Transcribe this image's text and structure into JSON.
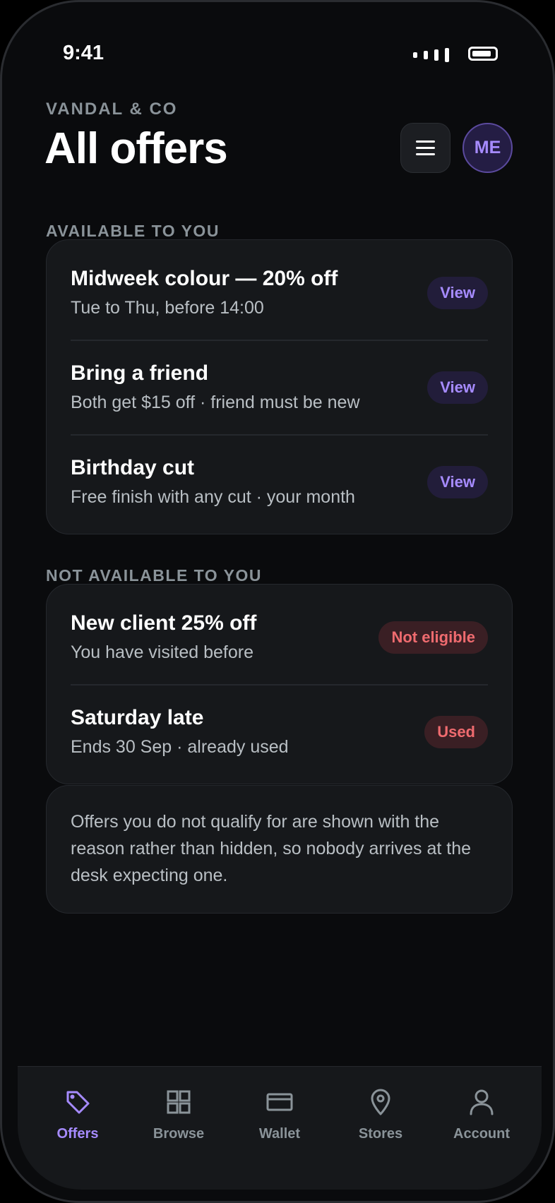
{
  "status_bar": {
    "time": "9:41"
  },
  "header": {
    "brand": "VANDAL & CO",
    "title": "All offers",
    "avatar_initials": "ME"
  },
  "available": {
    "label": "AVAILABLE TO YOU",
    "items": [
      {
        "title": "Midweek colour — 20% off",
        "subtitle": "Tue to Thu, before 14:00",
        "action": "View"
      },
      {
        "title": "Bring a friend",
        "subtitle": "Both get $15 off · friend must be new",
        "action": "View"
      },
      {
        "title": "Birthday cut",
        "subtitle": "Free finish with any cut · your month",
        "action": "View"
      }
    ]
  },
  "unavailable": {
    "label": "NOT AVAILABLE TO YOU",
    "items": [
      {
        "title": "New client 25% off",
        "subtitle": "You have visited before",
        "status": "Not eligible"
      },
      {
        "title": "Saturday late",
        "subtitle": "Ends 30 Sep · already used",
        "status": "Used"
      }
    ]
  },
  "note": "Offers you do not qualify for are shown with the reason rather than hidden, so nobody arrives at the desk expecting one.",
  "tabs": [
    {
      "label": "Offers",
      "icon": "tag-icon",
      "active": true
    },
    {
      "label": "Browse",
      "icon": "grid-icon",
      "active": false
    },
    {
      "label": "Wallet",
      "icon": "card-icon",
      "active": false
    },
    {
      "label": "Stores",
      "icon": "map-pin-icon",
      "active": false
    },
    {
      "label": "Account",
      "icon": "person-icon",
      "active": false
    }
  ],
  "colors": {
    "accent": "#a68bff",
    "danger": "#ef6b6f",
    "background": "#0a0b0d",
    "card": "#16181b"
  }
}
